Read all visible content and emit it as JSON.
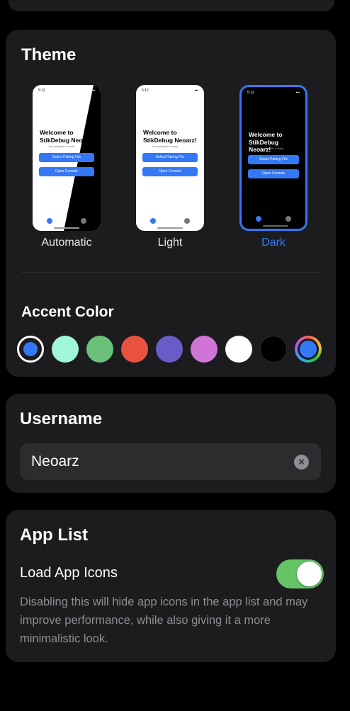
{
  "theme": {
    "title": "Theme",
    "options": [
      {
        "label": "Automatic",
        "selected": false
      },
      {
        "label": "Light",
        "selected": false
      },
      {
        "label": "Dark",
        "selected": true
      }
    ],
    "preview": {
      "status_time": "5:12",
      "welcome_line1": "Welcome to",
      "welcome_line2": "StikDebug Neoarz!",
      "subtitle": "Your pairing file is ready",
      "button1": "Select Pairing File",
      "button2": "Open Console"
    },
    "accent_title": "Accent Color",
    "accent_colors": [
      "#3478f6",
      "#9ff7d8",
      "#6cc17a",
      "#e9523f",
      "#6a5cc8",
      "#cf75d8",
      "#ffffff",
      "#000000",
      "multicolor"
    ],
    "accent_selected": 0
  },
  "username": {
    "title": "Username",
    "value": "Neoarz",
    "clear_icon": "xmark-circle-icon"
  },
  "app_list": {
    "title": "App List",
    "toggle_label": "Load App Icons",
    "toggle_on": true,
    "description": "Disabling this will hide app icons in the app list and may improve performance, while also giving it a more minimalistic look."
  },
  "colors": {
    "accent": "#3478f6",
    "toggle_on": "#65c466",
    "card": "#1c1c1e"
  }
}
